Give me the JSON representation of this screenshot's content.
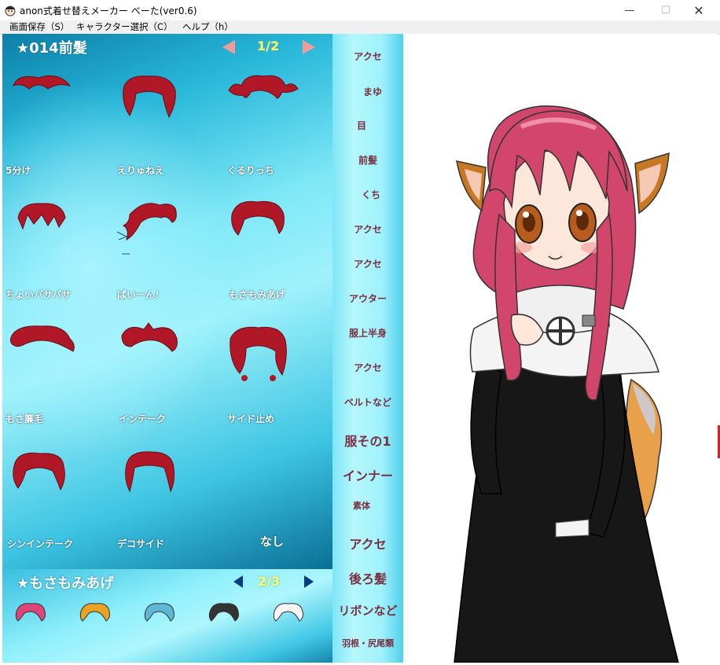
{
  "window": {
    "title": "anon式着せ替えメーカー べーた(ver0.6)",
    "minimize_glyph": "—",
    "maximize_glyph": "☐",
    "close_glyph": "✕"
  },
  "menu": [
    "画面保存（S）",
    "キャラクター選択（C）",
    "ヘルプ（h）"
  ],
  "hair_panel": {
    "title": "★014前髪",
    "page": "1/2",
    "items": [
      "5分け",
      "えりゅねえ",
      "くるりっち",
      "ちょいバサバサ",
      "ばいーん！",
      "もさもみあげ",
      "もさ簾毛",
      "インテーク",
      "サイド止め",
      "シンインテーク",
      "デコサイド",
      "なし"
    ]
  },
  "color_panel": {
    "title": "★もさもみあげ",
    "page": "2/3",
    "swatches": [
      "#e0457a",
      "#e8a322",
      "#5fb7d6",
      "#333333",
      "#f4f4f4"
    ]
  },
  "categories": [
    "アクセ",
    "まゆ",
    "目",
    "前髪",
    "くち",
    "アクセ",
    "アクセ",
    "アウター",
    "服上半身",
    "アクセ",
    "ベルトなど",
    "服その1",
    "インナー",
    "素体",
    "アクセ",
    "後ろ髪",
    "リボンなど",
    "羽根・尻尾類"
  ],
  "colors": {
    "hair_red": "#b01828",
    "panel_cyan": "#9ff2fb",
    "category_text": "#7a3040",
    "page_yellow": "#ffff66"
  }
}
